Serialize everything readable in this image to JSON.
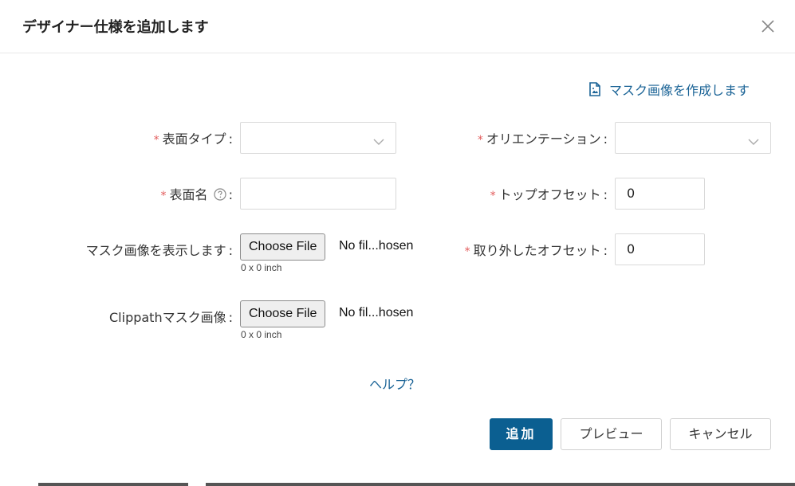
{
  "dialog": {
    "title": "デザイナー仕様を追加します",
    "close_icon": "close-icon"
  },
  "mask_link": {
    "label": "マスク画像を作成します",
    "icon": "image-file-icon"
  },
  "form": {
    "surface_type": {
      "required": "*",
      "label": "表面タイプ",
      "colon": ":",
      "value": ""
    },
    "orientation": {
      "required": "*",
      "label": "オリエンテーション",
      "colon": ":",
      "value": ""
    },
    "surface_name": {
      "required": "*",
      "label": "表面名",
      "colon": ":",
      "value": "",
      "help_icon": "question-circle-icon"
    },
    "top_offset": {
      "required": "*",
      "label": "トップオフセット",
      "colon": ":",
      "value": "0"
    },
    "display_mask": {
      "label": "マスク画像を表示します",
      "colon": ":",
      "button": "Choose File",
      "file_name": "No fil...hosen",
      "size": "0 x 0 inch"
    },
    "removed_offset": {
      "required": "*",
      "label": "取り外したオフセット",
      "colon": ":",
      "value": "0"
    },
    "clippath_mask": {
      "label": "Clippathマスク画像",
      "colon": ":",
      "button": "Choose File",
      "file_name": "No fil...hosen",
      "size": "0 x 0 inch"
    }
  },
  "help_link": "ヘルプ？",
  "footer": {
    "add": "追加",
    "preview": "プレビュー",
    "cancel": "キャンセル"
  },
  "colors": {
    "primary": "#0b5f91",
    "link": "#1a6396",
    "required": "#e25b5b"
  }
}
